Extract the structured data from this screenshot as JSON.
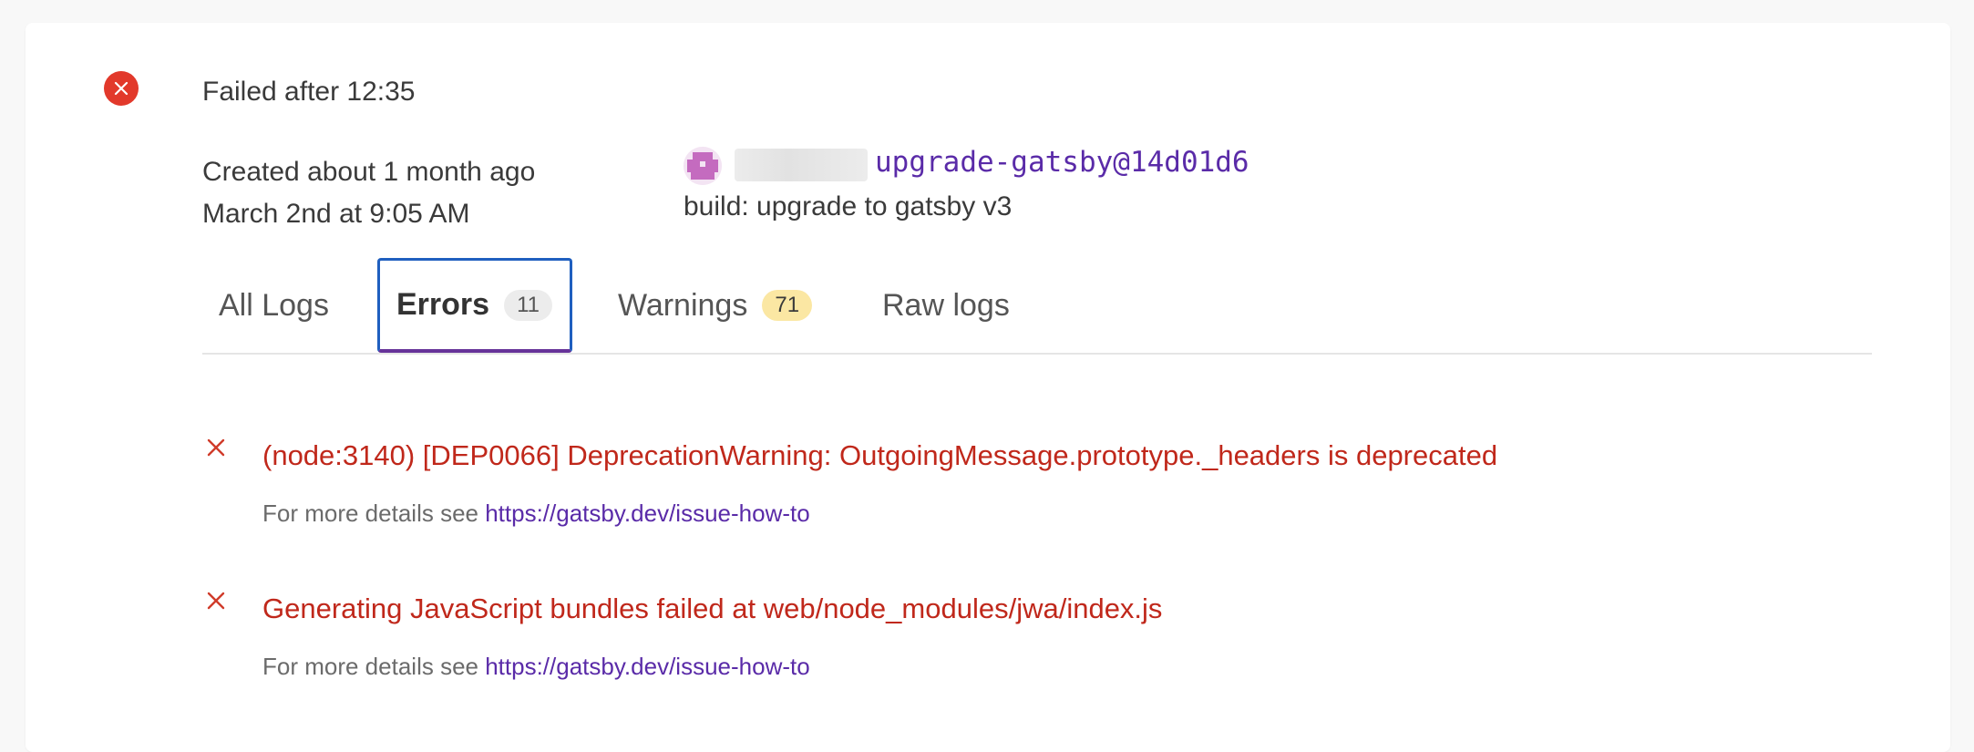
{
  "build": {
    "status_text": "Failed after 12:35",
    "created_relative": "Created about 1 month ago",
    "created_date": "March 2nd at 9:05 AM",
    "branch_ref": "upgrade-gatsby@14d01d6",
    "commit_message": "build: upgrade to gatsby v3"
  },
  "tabs": [
    {
      "label": "All Logs"
    },
    {
      "label": "Errors",
      "count": "11",
      "active": true
    },
    {
      "label": "Warnings",
      "count": "71"
    },
    {
      "label": "Raw logs"
    }
  ],
  "errors": [
    {
      "message": "(node:3140) [DEP0066] DeprecationWarning: OutgoingMessage.prototype._headers is deprecated",
      "details_prefix": "For more details see",
      "link": "https://gatsby.dev/issue-how-to"
    },
    {
      "message": "Generating JavaScript bundles failed at web/node_modules/jwa/index.js",
      "details_prefix": "For more details see",
      "link": "https://gatsby.dev/issue-how-to"
    }
  ],
  "icons": {
    "status": "error-circle-icon",
    "error_item": "close-icon",
    "avatar": "user-avatar"
  },
  "colors": {
    "error": "#c0281b",
    "link": "#5a2ba8",
    "active_tab_border": "#1f5fbf",
    "warning_badge": "#fbe7a3"
  }
}
